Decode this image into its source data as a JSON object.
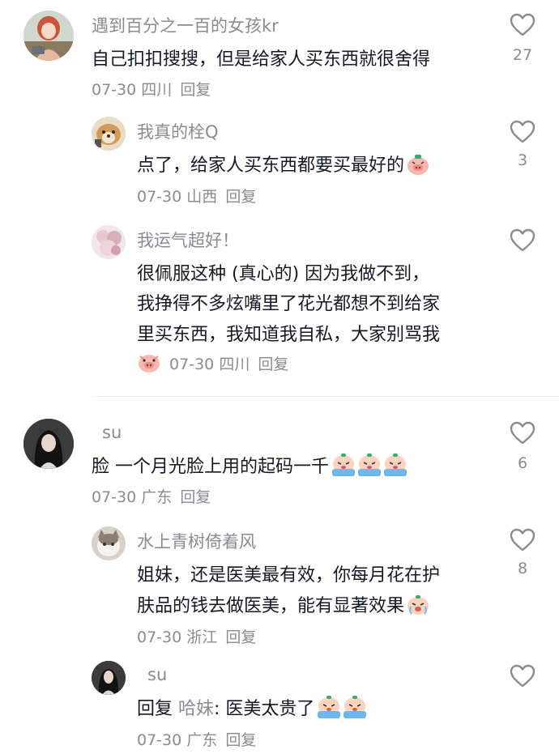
{
  "comments": [
    {
      "name": "遇到百分之一百的女孩kr",
      "text": "自己扣扣搜搜，但是给家人买东西就很舍得",
      "date": "07-30",
      "location": "四川",
      "reply_label": "回复",
      "likes": "27",
      "replies": [
        {
          "name": "我真的栓Q",
          "text": "点了，给家人买东西都要买最好的",
          "date": "07-30",
          "location": "山西",
          "reply_label": "回复",
          "likes": "3"
        },
        {
          "name": "我运气超好！",
          "lines": [
            "很佩服这种 (真心的) 因为我做不到，",
            "我挣得不多炫嘴里了花光都想不到给家",
            "里买东西，我知道我自私，大家别骂我"
          ],
          "date": "07-30",
          "location": "四川",
          "reply_label": "回复",
          "likes": ""
        }
      ]
    },
    {
      "name": "su",
      "text": "脸 一个月光脸上用的起码一千",
      "date": "07-30",
      "location": "广东",
      "reply_label": "回复",
      "likes": "6",
      "replies": [
        {
          "name": "水上青树倚着风",
          "lines": [
            "姐妹，还是医美最有效，你每月花在护",
            "肤品的钱去做医美，能有显著效果"
          ],
          "date": "07-30",
          "location": "浙江",
          "reply_label": "回复",
          "likes": "8"
        },
        {
          "name": "su",
          "reply_prefix": "回复",
          "reply_to": "哈妹",
          "text": ": 医美太贵了",
          "date": "07-30",
          "location": "广东",
          "reply_label": "回复",
          "likes": ""
        }
      ]
    }
  ],
  "icons": {
    "like": "heart-outline-icon"
  },
  "colors": {
    "text": "#161823",
    "secondary": "#8a8b91",
    "divider": "#eeeeef"
  }
}
